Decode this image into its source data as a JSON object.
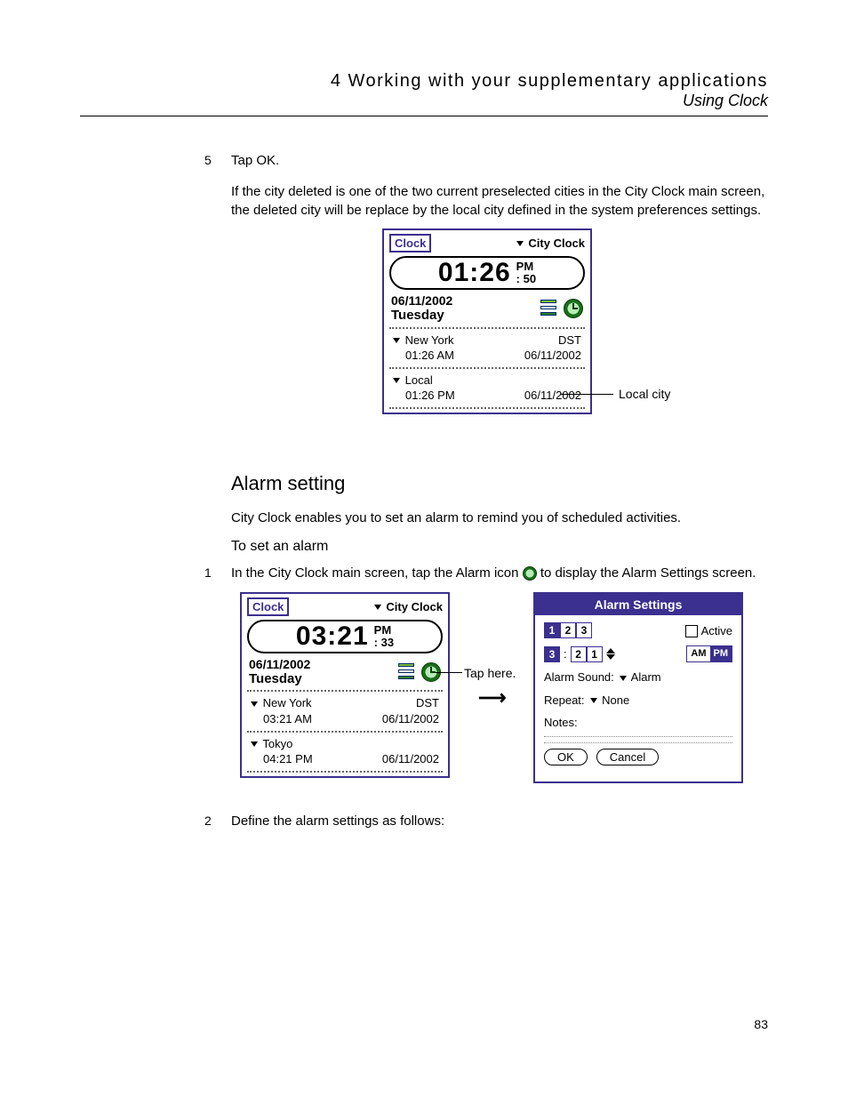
{
  "header": {
    "chapter": "4 Working with your supplementary applications",
    "subtitle": "Using Clock"
  },
  "page_number": "83",
  "step5": {
    "num": "5",
    "text": "Tap OK.",
    "detail": "If the city deleted is one of the two current preselected cities in the City Clock main screen, the deleted city will be replace by the local city defined in the system preferences settings."
  },
  "fig1": {
    "app_label": "Clock",
    "menu_label": "City Clock",
    "time": "01:26",
    "ampm": "PM",
    "seconds": ": 50",
    "date": "06/11/2002",
    "day": "Tuesday",
    "city1": {
      "name": "New York",
      "badge": "DST",
      "time": "01:26 AM",
      "date": "06/11/2002"
    },
    "city2": {
      "name": "Local",
      "badge": "",
      "time": "01:26 PM",
      "date": "06/11/2002"
    },
    "callout": "Local city"
  },
  "section": {
    "title": "Alarm setting",
    "intro": "City Clock enables you to set an alarm to remind you of scheduled activities.",
    "sub": "To set an alarm"
  },
  "step1": {
    "num": "1",
    "text_before": "In the City Clock main screen, tap the Alarm icon ",
    "text_after": " to display the Alarm Settings screen."
  },
  "fig2": {
    "pda": {
      "app_label": "Clock",
      "menu_label": "City Clock",
      "time": "03:21",
      "ampm": "PM",
      "seconds": ": 33",
      "date": "06/11/2002",
      "day": "Tuesday",
      "city1": {
        "name": "New York",
        "badge": "DST",
        "time": "03:21 AM",
        "date": "06/11/2002"
      },
      "city2": {
        "name": "Tokyo",
        "badge": "",
        "time": "04:21 PM",
        "date": "06/11/2002"
      }
    },
    "callout_tap": "Tap here.",
    "alarm": {
      "title": "Alarm Settings",
      "tabs": [
        "1",
        "2",
        "3"
      ],
      "tab_selected": 0,
      "active_label": "Active",
      "hour": "3",
      "min1": "2",
      "min2": "1",
      "am_label": "AM",
      "pm_label": "PM",
      "sound_label": "Alarm Sound:",
      "sound_value": "Alarm",
      "repeat_label": "Repeat:",
      "repeat_value": "None",
      "notes_label": "Notes:",
      "ok": "OK",
      "cancel": "Cancel"
    }
  },
  "step2": {
    "num": "2",
    "text": "Define the alarm settings as follows:"
  }
}
